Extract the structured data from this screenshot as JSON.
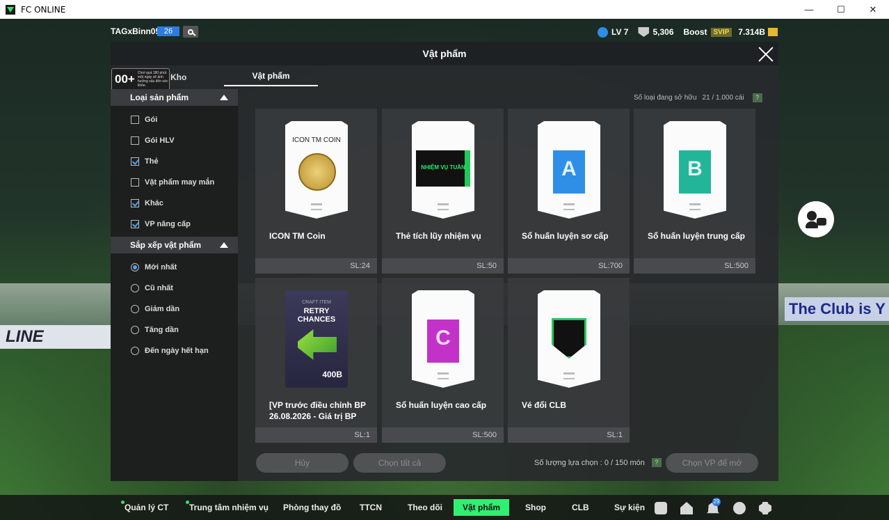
{
  "window": {
    "title": "FC ONLINE",
    "min_label": "—",
    "max_label": "☐",
    "close_label": "✕"
  },
  "hud": {
    "username": "TAGxBinn05",
    "level_badge": "26",
    "lv": "LV 7",
    "trophies": "5,306",
    "boost": "Boost",
    "svip": "SVIP",
    "bp": "7.314B"
  },
  "panel": {
    "title": "Vật phẩm",
    "age_num": "00+",
    "age_note": "Chơi quá 180 phút một ngày sẽ ảnh hưởng xấu đến sức khỏe.",
    "tab_kho": "Kho",
    "tab_vp": "Vật phẩm",
    "owned_label": "Số loại đang sở hữu",
    "owned_value": "21 / 1.000 cái",
    "help": "?"
  },
  "filters": {
    "type_header": "Loại sản phẩm",
    "types": [
      {
        "label": "Gói",
        "checked": false
      },
      {
        "label": "Gói HLV",
        "checked": false
      },
      {
        "label": "Thẻ",
        "checked": true
      },
      {
        "label": "Vật phẩm may mắn",
        "checked": false
      },
      {
        "label": "Khác",
        "checked": true
      },
      {
        "label": "VP nâng cấp",
        "checked": true
      }
    ],
    "sort_header": "Sắp xếp vật phẩm",
    "sorts": [
      {
        "label": "Mới nhất",
        "selected": true
      },
      {
        "label": "Cũ nhất",
        "selected": false
      },
      {
        "label": "Giảm dần",
        "selected": false
      },
      {
        "label": "Tăng dần",
        "selected": false
      },
      {
        "label": "Đến ngày hết hạn",
        "selected": false
      }
    ]
  },
  "items": [
    {
      "name": "ICON TM Coin",
      "qty": "SL:24",
      "art_caption": "ICON TM COIN"
    },
    {
      "name": "Thẻ tích lũy nhiệm vụ",
      "qty": "SL:50",
      "art_caption": "NHIỆM VỤ TUẦN"
    },
    {
      "name": "Sổ huấn luyện sơ cấp",
      "qty": "SL:700",
      "art_caption": "A",
      "book_color": "#2f8fe6"
    },
    {
      "name": "Sổ huấn luyện trung cấp",
      "qty": "SL:500",
      "art_caption": "B",
      "book_color": "#23b59a"
    },
    {
      "name": "[VP trước điều chỉnh BP 26.08.2026 - Giá trị BP",
      "qty": "SL:1",
      "art_caption": "RETRY CHANCES",
      "art_sub": "CRAFT ITEM",
      "art_value": "400B"
    },
    {
      "name": "Sổ huấn luyện cao cấp",
      "qty": "SL:500",
      "art_caption": "C",
      "book_color": "#c332c8"
    },
    {
      "name": "Vé đổi CLB",
      "qty": "SL:1",
      "art_caption": ""
    }
  ],
  "actions": {
    "cancel": "Hủy",
    "select_all": "Chọn tất cả",
    "select_count_label": "Số lượng lựa chọn : 0 / 150 món",
    "choose": "Chọn VP để mở"
  },
  "background": {
    "banner_right": "The Club is Y",
    "banner_left": "LINE"
  },
  "nav": {
    "items": [
      "Quản lý CT",
      "Trung tâm nhiệm vụ",
      "Phòng thay đồ",
      "TTCN",
      "Theo dõi",
      "Vật phẩm",
      "Shop",
      "CLB",
      "Sự kiện"
    ],
    "notification_count": "29"
  },
  "colors": {
    "accent": "#2ff072",
    "check": "#4aa3ff",
    "level_badge": "#2d7be0"
  }
}
